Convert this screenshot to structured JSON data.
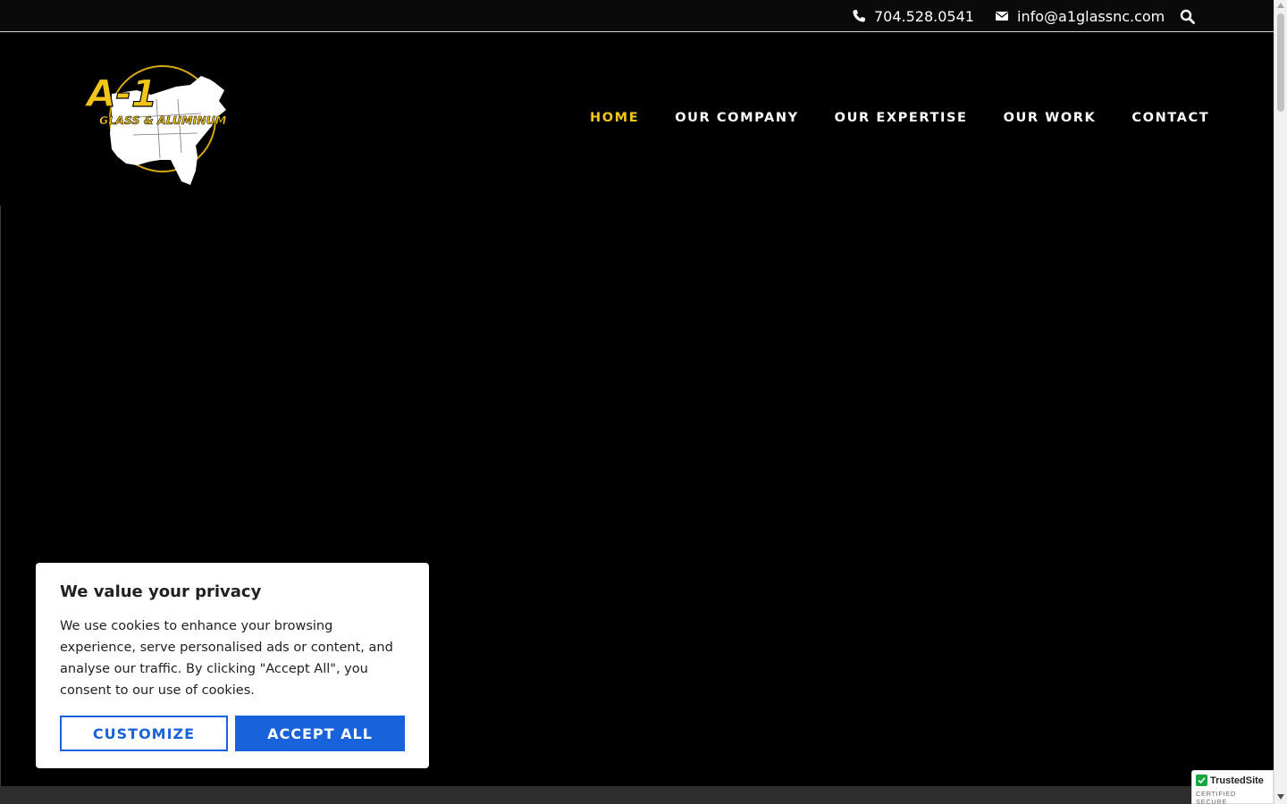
{
  "topbar": {
    "phone": "704.528.0541",
    "email": "info@a1glassnc.com",
    "phone_icon": "phone-icon",
    "email_icon": "envelope-icon",
    "search_icon": "search-icon"
  },
  "logo": {
    "text_main": "A-1",
    "text_sub": "GLASS & ALUMINUM",
    "colors": {
      "gold": "#f3c519",
      "white": "#ffffff"
    }
  },
  "nav": {
    "items": [
      {
        "label": "HOME",
        "active": true
      },
      {
        "label": "OUR COMPANY"
      },
      {
        "label": "OUR EXPERTISE"
      },
      {
        "label": "OUR WORK"
      },
      {
        "label": "CONTACT"
      }
    ],
    "active_color": "#f3c519"
  },
  "cookie": {
    "title": "We value your privacy",
    "body": "We use cookies to enhance your browsing experience, serve personalised ads or content, and analyse our traffic. By clicking \"Accept All\", you consent to our use of cookies.",
    "customize_label": "CUSTOMIZE",
    "accept_label": "ACCEPT ALL",
    "accent": "#1863dc"
  },
  "trusted": {
    "name": "TrustedSite",
    "sub": "CERTIFIED SECURE"
  }
}
